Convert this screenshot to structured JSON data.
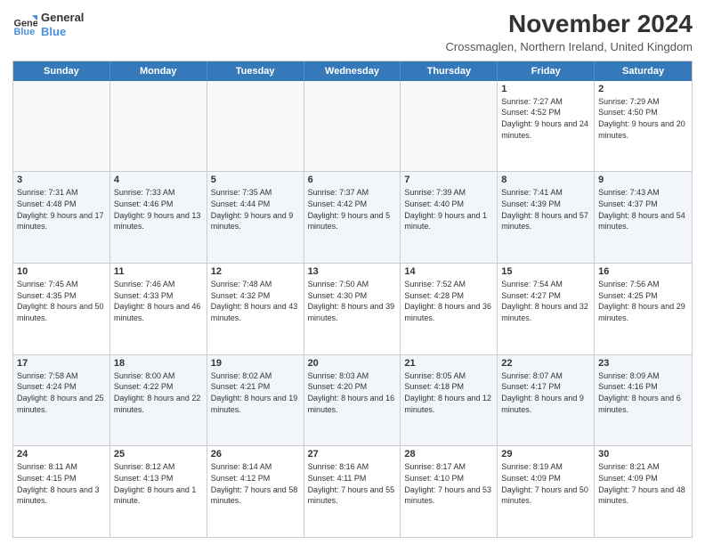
{
  "logo": {
    "line1": "General",
    "line2": "Blue"
  },
  "title": "November 2024",
  "location": "Crossmaglen, Northern Ireland, United Kingdom",
  "headers": [
    "Sunday",
    "Monday",
    "Tuesday",
    "Wednesday",
    "Thursday",
    "Friday",
    "Saturday"
  ],
  "rows": [
    [
      {
        "day": "",
        "info": "",
        "empty": true
      },
      {
        "day": "",
        "info": "",
        "empty": true
      },
      {
        "day": "",
        "info": "",
        "empty": true
      },
      {
        "day": "",
        "info": "",
        "empty": true
      },
      {
        "day": "",
        "info": "",
        "empty": true
      },
      {
        "day": "1",
        "info": "Sunrise: 7:27 AM\nSunset: 4:52 PM\nDaylight: 9 hours and 24 minutes."
      },
      {
        "day": "2",
        "info": "Sunrise: 7:29 AM\nSunset: 4:50 PM\nDaylight: 9 hours and 20 minutes."
      }
    ],
    [
      {
        "day": "3",
        "info": "Sunrise: 7:31 AM\nSunset: 4:48 PM\nDaylight: 9 hours and 17 minutes."
      },
      {
        "day": "4",
        "info": "Sunrise: 7:33 AM\nSunset: 4:46 PM\nDaylight: 9 hours and 13 minutes."
      },
      {
        "day": "5",
        "info": "Sunrise: 7:35 AM\nSunset: 4:44 PM\nDaylight: 9 hours and 9 minutes."
      },
      {
        "day": "6",
        "info": "Sunrise: 7:37 AM\nSunset: 4:42 PM\nDaylight: 9 hours and 5 minutes."
      },
      {
        "day": "7",
        "info": "Sunrise: 7:39 AM\nSunset: 4:40 PM\nDaylight: 9 hours and 1 minute."
      },
      {
        "day": "8",
        "info": "Sunrise: 7:41 AM\nSunset: 4:39 PM\nDaylight: 8 hours and 57 minutes."
      },
      {
        "day": "9",
        "info": "Sunrise: 7:43 AM\nSunset: 4:37 PM\nDaylight: 8 hours and 54 minutes."
      }
    ],
    [
      {
        "day": "10",
        "info": "Sunrise: 7:45 AM\nSunset: 4:35 PM\nDaylight: 8 hours and 50 minutes."
      },
      {
        "day": "11",
        "info": "Sunrise: 7:46 AM\nSunset: 4:33 PM\nDaylight: 8 hours and 46 minutes."
      },
      {
        "day": "12",
        "info": "Sunrise: 7:48 AM\nSunset: 4:32 PM\nDaylight: 8 hours and 43 minutes."
      },
      {
        "day": "13",
        "info": "Sunrise: 7:50 AM\nSunset: 4:30 PM\nDaylight: 8 hours and 39 minutes."
      },
      {
        "day": "14",
        "info": "Sunrise: 7:52 AM\nSunset: 4:28 PM\nDaylight: 8 hours and 36 minutes."
      },
      {
        "day": "15",
        "info": "Sunrise: 7:54 AM\nSunset: 4:27 PM\nDaylight: 8 hours and 32 minutes."
      },
      {
        "day": "16",
        "info": "Sunrise: 7:56 AM\nSunset: 4:25 PM\nDaylight: 8 hours and 29 minutes."
      }
    ],
    [
      {
        "day": "17",
        "info": "Sunrise: 7:58 AM\nSunset: 4:24 PM\nDaylight: 8 hours and 25 minutes."
      },
      {
        "day": "18",
        "info": "Sunrise: 8:00 AM\nSunset: 4:22 PM\nDaylight: 8 hours and 22 minutes."
      },
      {
        "day": "19",
        "info": "Sunrise: 8:02 AM\nSunset: 4:21 PM\nDaylight: 8 hours and 19 minutes."
      },
      {
        "day": "20",
        "info": "Sunrise: 8:03 AM\nSunset: 4:20 PM\nDaylight: 8 hours and 16 minutes."
      },
      {
        "day": "21",
        "info": "Sunrise: 8:05 AM\nSunset: 4:18 PM\nDaylight: 8 hours and 12 minutes."
      },
      {
        "day": "22",
        "info": "Sunrise: 8:07 AM\nSunset: 4:17 PM\nDaylight: 8 hours and 9 minutes."
      },
      {
        "day": "23",
        "info": "Sunrise: 8:09 AM\nSunset: 4:16 PM\nDaylight: 8 hours and 6 minutes."
      }
    ],
    [
      {
        "day": "24",
        "info": "Sunrise: 8:11 AM\nSunset: 4:15 PM\nDaylight: 8 hours and 3 minutes."
      },
      {
        "day": "25",
        "info": "Sunrise: 8:12 AM\nSunset: 4:13 PM\nDaylight: 8 hours and 1 minute."
      },
      {
        "day": "26",
        "info": "Sunrise: 8:14 AM\nSunset: 4:12 PM\nDaylight: 7 hours and 58 minutes."
      },
      {
        "day": "27",
        "info": "Sunrise: 8:16 AM\nSunset: 4:11 PM\nDaylight: 7 hours and 55 minutes."
      },
      {
        "day": "28",
        "info": "Sunrise: 8:17 AM\nSunset: 4:10 PM\nDaylight: 7 hours and 53 minutes."
      },
      {
        "day": "29",
        "info": "Sunrise: 8:19 AM\nSunset: 4:09 PM\nDaylight: 7 hours and 50 minutes."
      },
      {
        "day": "30",
        "info": "Sunrise: 8:21 AM\nSunset: 4:09 PM\nDaylight: 7 hours and 48 minutes."
      }
    ]
  ]
}
